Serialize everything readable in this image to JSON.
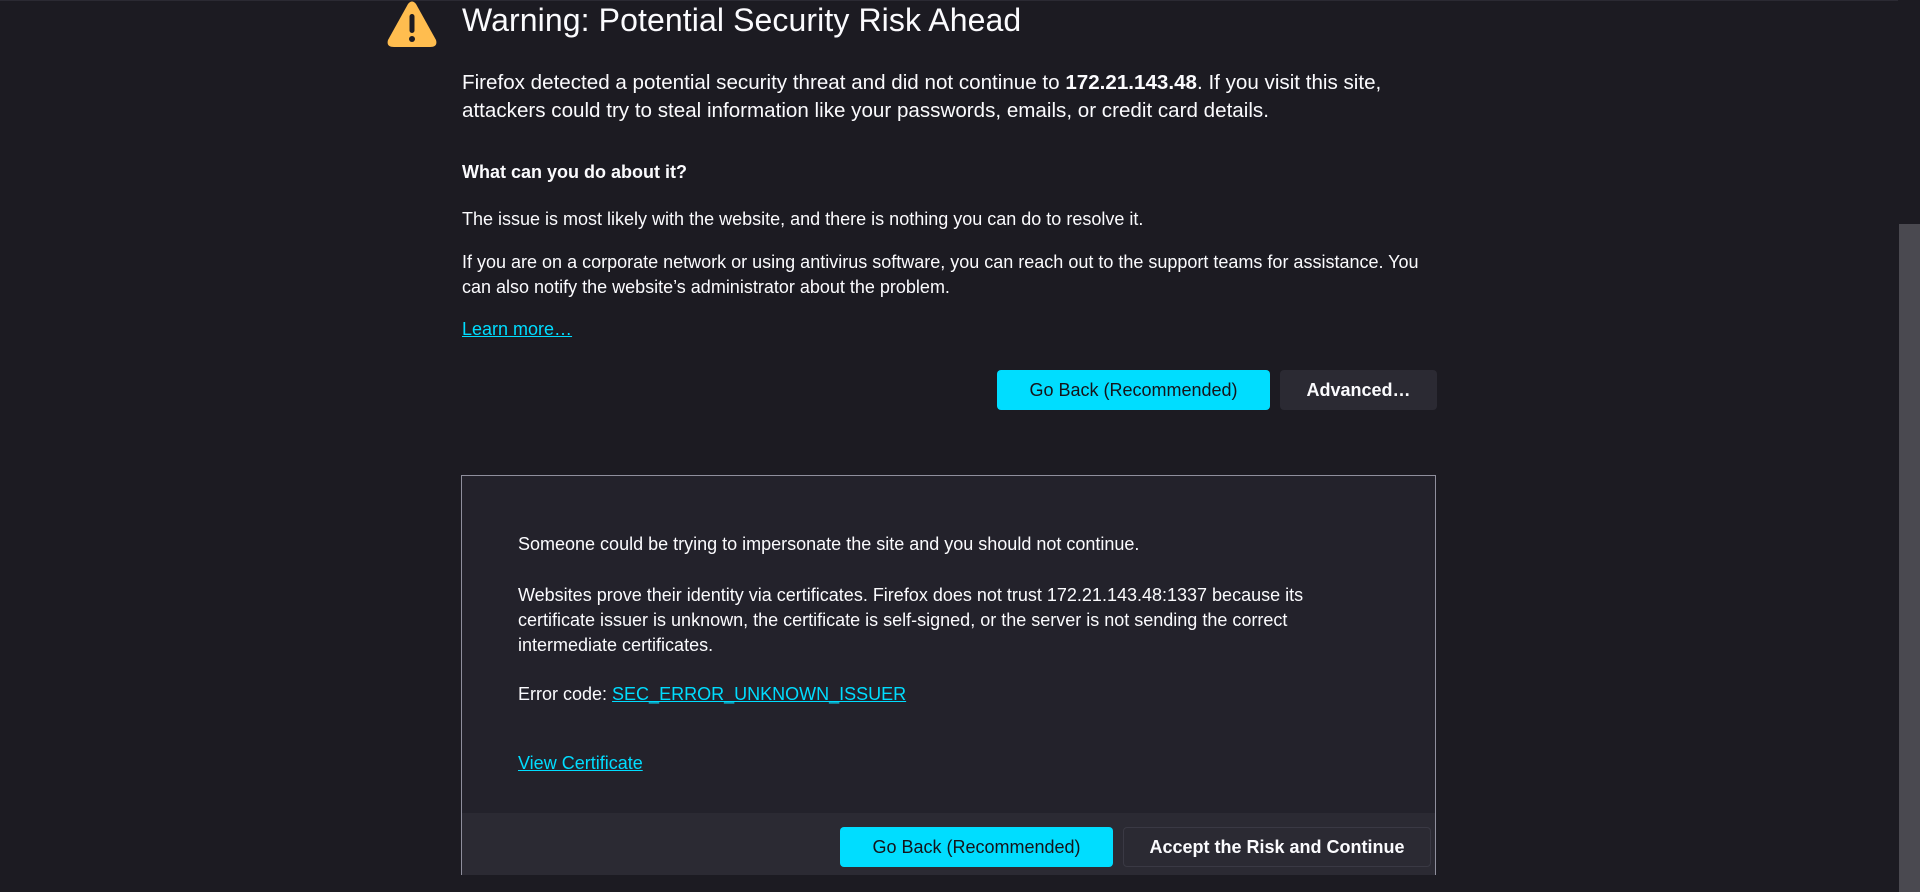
{
  "header": {
    "icon": "warning-triangle-icon",
    "title": "Warning: Potential Security Risk Ahead"
  },
  "intro": {
    "before": "Firefox detected a potential security threat and did not continue to ",
    "host": "172.21.143.48",
    "after": ". If you visit this site, attackers could try to steal information like your passwords, emails, or credit card details."
  },
  "what_to_do": {
    "heading": "What can you do about it?",
    "para1": "The issue is most likely with the website, and there is nothing you can do to resolve it.",
    "para2": "If you are on a corporate network or using antivirus software, you can reach out to the support teams for assistance. You can also notify the website’s administrator about the problem.",
    "learn_more": "Learn more…"
  },
  "buttons": {
    "go_back": "Go Back (Recommended)",
    "advanced": "Advanced…"
  },
  "advanced_panel": {
    "text1": "Someone could be trying to impersonate the site and you should not continue.",
    "text2": "Websites prove their identity via certificates. Firefox does not trust 172.21.143.48:1337 because its certificate issuer is unknown, the certificate is self-signed, or the server is not sending the correct intermediate certificates.",
    "error_code_label": "Error code: ",
    "error_code": "SEC_ERROR_UNKNOWN_ISSUER",
    "view_certificate": "View Certificate",
    "go_back": "Go Back (Recommended)",
    "accept_risk": "Accept the Risk and Continue"
  },
  "colors": {
    "background": "#1c1b22",
    "panel": "#23222b",
    "accent": "#00ddff",
    "warning": "#ffbd4f"
  }
}
